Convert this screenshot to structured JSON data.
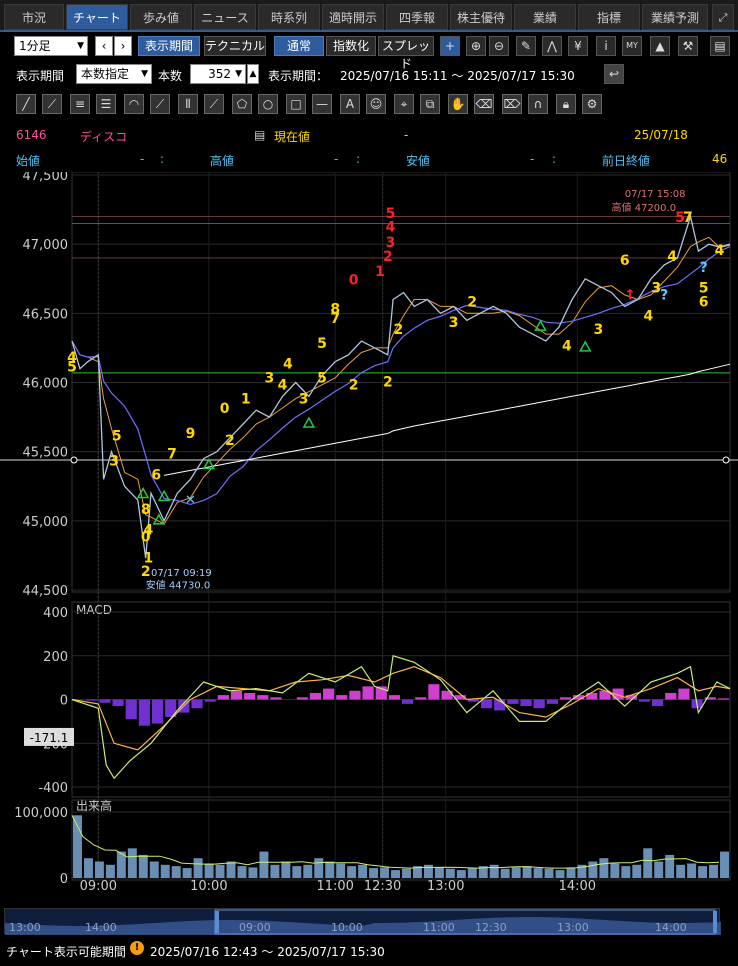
{
  "tabs": [
    "市況",
    "チャート",
    "歩み値",
    "ニュース",
    "時系列",
    "適時開示",
    "四季報",
    "株主優待",
    "業績",
    "指標",
    "業績予測"
  ],
  "toolbar": {
    "interval": "1分足",
    "period_button": "表示期間",
    "technical_button": "テクニカル",
    "normal_button": "通常",
    "index_button": "指数化",
    "spread_button": "スプレッド"
  },
  "period_row": {
    "label": "表示期間",
    "mode": "本数指定",
    "count_label": "本数",
    "count_value": "352",
    "range_label": "表示期間：",
    "range_value": "2025/07/16 15:11 ～ 2025/07/17 15:30"
  },
  "stock": {
    "code": "6146",
    "name": "ディスコ",
    "current_label": "現在値",
    "current_value": "-",
    "date": "25/07/18",
    "open_label": "始値",
    "open_value": "-",
    "open_time": ":",
    "high_label": "高値",
    "high_value": "-",
    "high_time": ":",
    "low_label": "安値",
    "low_value": "-",
    "low_time": ":",
    "prev_label": "前日終値",
    "prev_value": "46"
  },
  "chart_data": {
    "type": "line",
    "price_axis": {
      "ticks": [
        "47,500",
        "47,000",
        "46,500",
        "46,000",
        "45,500",
        "45,000",
        "44,500"
      ],
      "ylim": [
        44500,
        47500
      ]
    },
    "time_axis": [
      "09:00",
      "10:00",
      "11:00",
      "12:30",
      "13:00",
      "14:00"
    ],
    "annotations": {
      "high_time": "07/17 15:08",
      "high_text": "高値 47200.0",
      "low_time": "07/17 09:19",
      "low_text": "安値 44730.0"
    },
    "series": [
      {
        "name": "price",
        "points": [
          [
            0,
            46300
          ],
          [
            3,
            46100
          ],
          [
            6,
            46150
          ],
          [
            10,
            46200
          ],
          [
            12,
            45300
          ],
          [
            15,
            45500
          ],
          [
            20,
            45250
          ],
          [
            25,
            45150
          ],
          [
            28,
            44730
          ],
          [
            30,
            45200
          ],
          [
            35,
            45000
          ],
          [
            40,
            45200
          ],
          [
            45,
            45300
          ],
          [
            50,
            45450
          ],
          [
            55,
            45500
          ],
          [
            60,
            45600
          ],
          [
            65,
            45700
          ],
          [
            70,
            45800
          ],
          [
            75,
            45750
          ],
          [
            80,
            45900
          ],
          [
            85,
            46000
          ],
          [
            90,
            45900
          ],
          [
            95,
            46050
          ],
          [
            100,
            46150
          ],
          [
            105,
            46200
          ],
          [
            110,
            46300
          ],
          [
            115,
            46250
          ],
          [
            120,
            46200
          ],
          [
            122,
            46600
          ],
          [
            126,
            46650
          ],
          [
            130,
            46550
          ],
          [
            135,
            46600
          ],
          [
            140,
            46500
          ],
          [
            145,
            46550
          ],
          [
            150,
            46450
          ],
          [
            155,
            46500
          ],
          [
            160,
            46550
          ],
          [
            165,
            46500
          ],
          [
            170,
            46400
          ],
          [
            175,
            46350
          ],
          [
            180,
            46300
          ],
          [
            185,
            46400
          ],
          [
            190,
            46600
          ],
          [
            195,
            46750
          ],
          [
            200,
            46700
          ],
          [
            205,
            46650
          ],
          [
            210,
            46550
          ],
          [
            215,
            46600
          ],
          [
            220,
            46750
          ],
          [
            225,
            46850
          ],
          [
            230,
            46900
          ],
          [
            235,
            47200
          ],
          [
            238,
            46950
          ],
          [
            242,
            47000
          ],
          [
            246,
            46980
          ],
          [
            250,
            47000
          ]
        ]
      }
    ]
  },
  "macd": {
    "title": "MACD",
    "ticks": [
      "400",
      "200",
      "0",
      "-200",
      "-400"
    ],
    "cursor_value": "-171.1",
    "line": [
      [
        0,
        0
      ],
      [
        10,
        -40
      ],
      [
        13,
        -300
      ],
      [
        16,
        -360
      ],
      [
        22,
        -280
      ],
      [
        30,
        -200
      ],
      [
        40,
        -50
      ],
      [
        50,
        80
      ],
      [
        60,
        40
      ],
      [
        70,
        50
      ],
      [
        80,
        30
      ],
      [
        90,
        120
      ],
      [
        100,
        80
      ],
      [
        110,
        150
      ],
      [
        115,
        60
      ],
      [
        120,
        40
      ],
      [
        122,
        200
      ],
      [
        130,
        170
      ],
      [
        140,
        90
      ],
      [
        150,
        -60
      ],
      [
        160,
        40
      ],
      [
        170,
        -100
      ],
      [
        180,
        -100
      ],
      [
        190,
        0
      ],
      [
        200,
        80
      ],
      [
        210,
        -30
      ],
      [
        220,
        80
      ],
      [
        230,
        120
      ],
      [
        235,
        150
      ],
      [
        238,
        -60
      ],
      [
        245,
        80
      ],
      [
        250,
        50
      ]
    ],
    "signal": [
      [
        0,
        0
      ],
      [
        10,
        -20
      ],
      [
        16,
        -200
      ],
      [
        25,
        -230
      ],
      [
        35,
        -120
      ],
      [
        45,
        0
      ],
      [
        55,
        60
      ],
      [
        65,
        50
      ],
      [
        75,
        40
      ],
      [
        85,
        80
      ],
      [
        95,
        90
      ],
      [
        105,
        110
      ],
      [
        115,
        80
      ],
      [
        122,
        120
      ],
      [
        130,
        150
      ],
      [
        140,
        100
      ],
      [
        150,
        0
      ],
      [
        160,
        10
      ],
      [
        170,
        -60
      ],
      [
        180,
        -80
      ],
      [
        190,
        -20
      ],
      [
        200,
        50
      ],
      [
        210,
        10
      ],
      [
        220,
        50
      ],
      [
        230,
        100
      ],
      [
        238,
        40
      ],
      [
        245,
        60
      ],
      [
        250,
        50
      ]
    ],
    "histogram": [
      0,
      -5,
      -15,
      -30,
      -90,
      -120,
      -110,
      -80,
      -60,
      -40,
      -10,
      20,
      40,
      30,
      20,
      10,
      0,
      10,
      30,
      50,
      20,
      40,
      60,
      60,
      20,
      -20,
      10,
      70,
      40,
      20,
      -10,
      -40,
      -50,
      -20,
      -30,
      -40,
      -20,
      10,
      20,
      30,
      40,
      50,
      20,
      -10,
      -30,
      30,
      50,
      -40,
      10,
      5
    ]
  },
  "volume": {
    "title": "出来高",
    "ticks": [
      "100,000",
      "0"
    ],
    "bars": [
      95,
      30,
      25,
      20,
      40,
      45,
      35,
      25,
      20,
      18,
      15,
      30,
      22,
      20,
      25,
      18,
      16,
      40,
      20,
      25,
      18,
      20,
      30,
      25,
      22,
      18,
      20,
      15,
      16,
      12,
      14,
      18,
      20,
      16,
      14,
      12,
      15,
      18,
      20,
      14,
      16,
      18,
      15,
      14,
      12,
      16,
      20,
      25,
      30,
      22,
      18,
      20,
      45,
      25,
      35,
      20,
      22,
      18,
      20,
      40
    ]
  },
  "navigator": {
    "ticks": [
      "13:00",
      "14:00",
      "09:00",
      "10:00",
      "11:00",
      "12:30",
      "13:00",
      "14:00"
    ]
  },
  "footer": {
    "label": "チャート表示可能期間",
    "range": "2025/07/16 12:43 ～ 2025/07/17 15:30"
  },
  "colors": {
    "accent": "#2f5c9c",
    "grid": "#333333",
    "price": "#b0c4de",
    "ma1": "#e8a03a",
    "ma2": "#7070ff",
    "ma3": "#ffffff",
    "macd": "#ffb347",
    "signal": "#c8f070",
    "hist_pos": "#d040d0",
    "hist_neg": "#7030d0",
    "sign_up": "#22cc44",
    "number": "#ffd700",
    "red": "#ff2020"
  }
}
